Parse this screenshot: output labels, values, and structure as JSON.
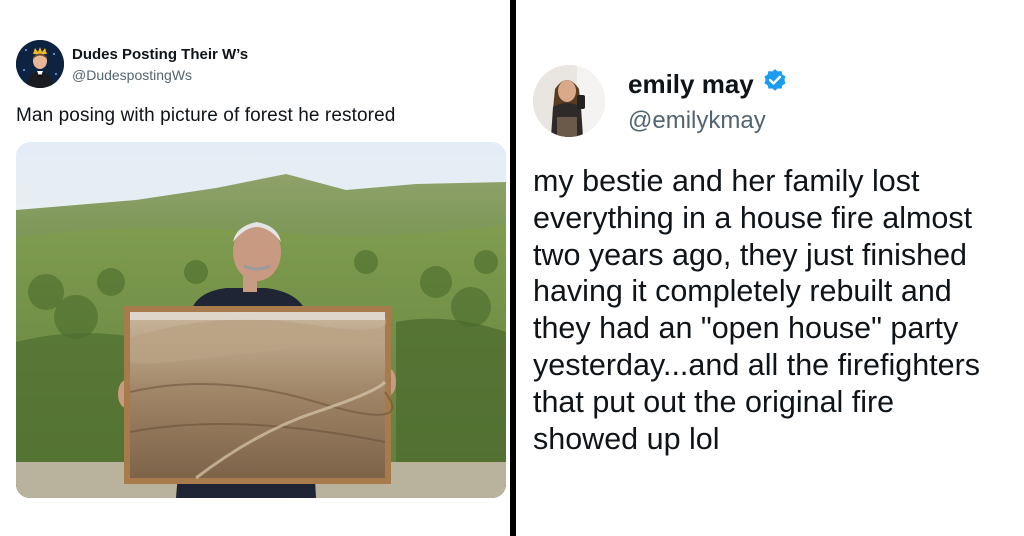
{
  "left_tweet": {
    "display_name": "Dudes Posting Their W’s",
    "handle": "@DudespostingWs",
    "text": "Man posing with picture of forest he restored",
    "avatar_icon": "crowned-man-avatar-icon",
    "photo": "man-holding-framed-photo-of-barren-hills-in-front-of-green-forest"
  },
  "right_tweet": {
    "display_name": "emily may",
    "handle": "@emilykmay",
    "verified": true,
    "verified_color": "#1d9bf0",
    "text_lines": [
      "my bestie and her family lost",
      "everything in a house fire almost",
      "two years ago, they just finished",
      "having it completely rebuilt and",
      "they had an \"open house\" party",
      "yesterday...and all the firefighters",
      "that put out the original fire",
      "showed up lol"
    ]
  },
  "colors": {
    "text_primary": "#0f1419",
    "text_secondary": "#536471",
    "divider": "#000000"
  }
}
